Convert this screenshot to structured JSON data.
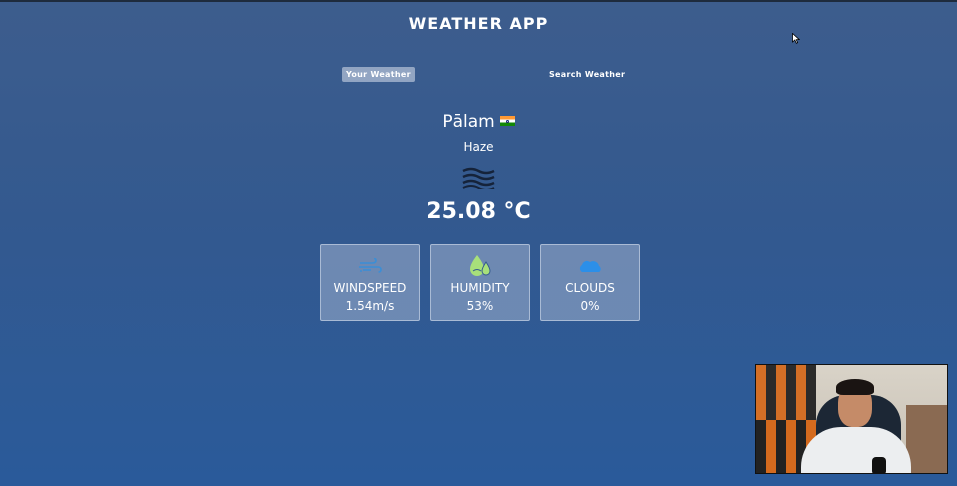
{
  "app": {
    "title": "WEATHER APP"
  },
  "tabs": {
    "your_weather": "Your Weather",
    "search_weather": "Search Weather"
  },
  "weather": {
    "city": "Pālam",
    "country_flag": "india-flag-icon",
    "condition": "Haze",
    "condition_icon": "haze-icon",
    "temperature": "25.08 °C"
  },
  "stats": [
    {
      "icon": "wind-icon",
      "label": "WINDSPEED",
      "value": "1.54m/s"
    },
    {
      "icon": "humidity-icon",
      "label": "HUMIDITY",
      "value": "53%"
    },
    {
      "icon": "cloud-icon",
      "label": "CLOUDS",
      "value": "0%"
    }
  ],
  "colors": {
    "background": "#33598f",
    "active_tab": "#dbe2ef",
    "wind_icon": "#3b8ed6",
    "humidity_icon": "#a8e07a",
    "cloud_icon": "#2c8fe8"
  }
}
